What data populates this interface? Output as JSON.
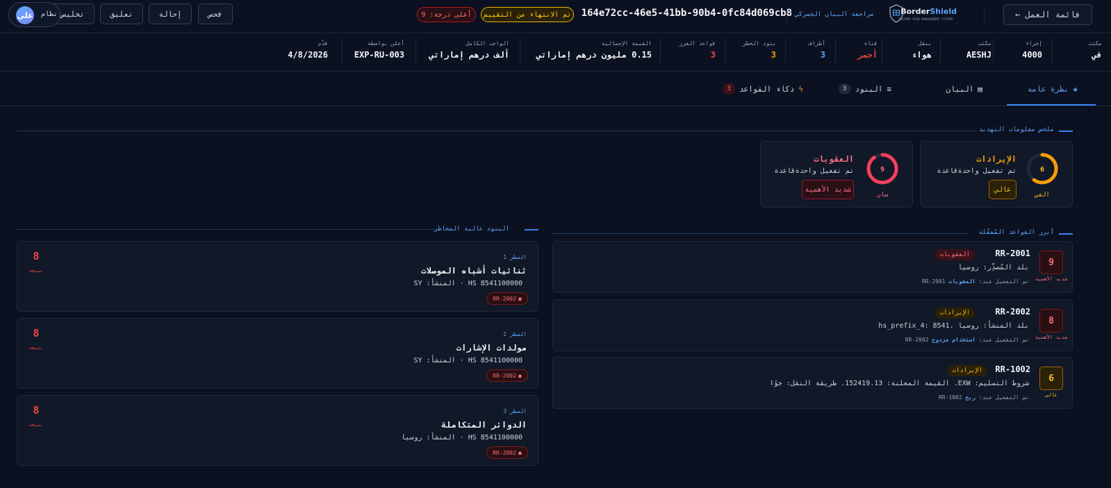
{
  "header": {
    "worklist_label": "قائمة العمل ←",
    "brand_name_a": "Border",
    "brand_name_b": "Shield",
    "brand_tagline": "CUSTOMS RISK MANAGEMENT SYSTEM",
    "review_title": "مراجعة البيان الجمركي",
    "declaration_id": "164e72cc-46e5-41bb-90b4-0fc84d069cb8",
    "status_pill": "تم الانتهاء من التقييم",
    "score_pill": "أعلى درجة: 9",
    "actions": {
      "check": "فحص",
      "refer": "إحالة",
      "suspend": "تعليق",
      "clear": "تخليص"
    },
    "user": {
      "initials": "علي",
      "role": "نظام"
    }
  },
  "meta": [
    {
      "label": "مكتب",
      "value": "في"
    },
    {
      "label": "إجراء",
      "value": "4000"
    },
    {
      "label": "مكتب",
      "value": "AESHJ"
    },
    {
      "label": "بنقل",
      "value": "هواء"
    },
    {
      "label": "قناة",
      "value": "أحمر"
    },
    {
      "label": "أطراف",
      "value": "3"
    },
    {
      "label": "بنود الخطر",
      "value": "3"
    },
    {
      "label": "قواعد الفرز",
      "value": "3"
    },
    {
      "label": "القيمة الإجمالية",
      "value": "0.15 مليون درهم إماراتي"
    },
    {
      "label": "الواجب الكامل",
      "value": "ألف درهم إماراتي"
    },
    {
      "label": "أعلن بواسطة",
      "value": "EXP-RU-003"
    },
    {
      "label": "قدّم",
      "value": "4/8/2026"
    }
  ],
  "tabs": [
    {
      "label": "نظرة عامة",
      "icon": "diamond-icon"
    },
    {
      "label": "البيان",
      "icon": "document-icon"
    },
    {
      "label": "البنود",
      "icon": "list-icon",
      "count": "3"
    },
    {
      "label": "ذكاء القواعد",
      "icon": "lightning-icon",
      "count": "3"
    }
  ],
  "threat_summary": {
    "title": "ملخص معلومات التهديد",
    "cards": [
      {
        "title": "الإيرادات",
        "subtitle": "تم تفعيل واحدةقاعدة",
        "score": "6",
        "score_label": "القي",
        "badge": "عالي",
        "color": "#f59e0b"
      },
      {
        "title": "العقوبات",
        "subtitle": "تم تفعيل واحدةقاعدة",
        "score": "9",
        "score_label": "سان",
        "badge": "شديد الأهمية",
        "color": "#f43f5e"
      }
    ]
  },
  "top_rules": {
    "title": "أبرز القواعد المُفعّلة",
    "items": [
      {
        "id": "RR-2001",
        "tag": "العقوبات",
        "desc": "بلد المُصدِّر: روسيا",
        "trigger_prefix": "تم التفعيل عند:",
        "trigger_name": "العقوبات",
        "trigger_id": "RR-2001",
        "score": "9",
        "score_label": "شديد الأهمية"
      },
      {
        "id": "RR-2002",
        "tag": "الإيرادات",
        "desc": "بلد المنشأ: روسيا .hs_prefix_4: 8541",
        "trigger_prefix": "تم التفعيل عند:",
        "trigger_name": "استخدام مزدوج",
        "trigger_id": "RR-2002",
        "score": "8",
        "score_label": "شديد الأهمية"
      },
      {
        "id": "RR-1002",
        "tag": "الإيرادات",
        "desc": "شروط التسليم: EXW. القيمة المعلنة: 152419.13. طريقة النقل: جوًا",
        "trigger_prefix": "تم التفعيل عند:",
        "trigger_name": "ربح",
        "trigger_id": "RR-1002",
        "score": "6",
        "score_label": "عالي"
      }
    ]
  },
  "high_risk_lines": {
    "title": "البنود عالية المخاطر",
    "items": [
      {
        "line": "السطر 1",
        "title": "ثنائيات أشباه الموصلات",
        "sub": "HS 8541100000 · المنشأ: SY",
        "rule": "RR-2002",
        "score": "8",
        "score_label": "نتيجة"
      },
      {
        "line": "السطر 2",
        "title": "مولدات الإشارات",
        "sub": "HS 8541100000 · المنشأ: SY",
        "rule": "RR-2002",
        "score": "8",
        "score_label": "نتيجة"
      },
      {
        "line": "السطر 3",
        "title": "الدوائر المتكاملة",
        "sub": "HS 8541100000 · المنشأ: روسيا",
        "rule": "RR-2002",
        "score": "8",
        "score_label": "نتيجة"
      }
    ]
  }
}
